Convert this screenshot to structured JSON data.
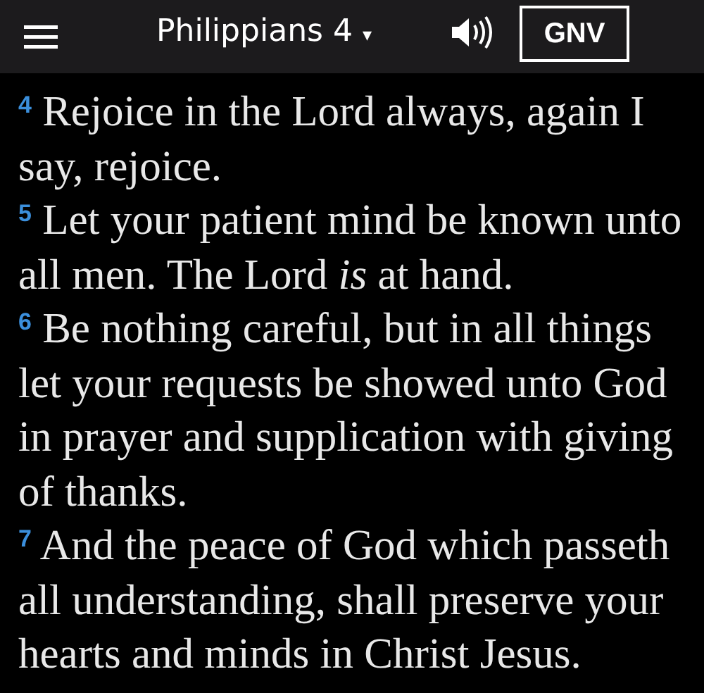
{
  "header": {
    "title": "Philippians 4",
    "dropdown_caret": "▾",
    "version": "GNV"
  },
  "verses": [
    {
      "number": "4",
      "text": "Rejoice in the Lord always, again I say, rejoice."
    },
    {
      "number": "5",
      "text": "Let your patient mind be known unto all men. The Lord *is* at hand."
    },
    {
      "number": "6",
      "text": "Be nothing careful, but in all things let your requests be showed unto God in prayer and supplication with giving of thanks."
    },
    {
      "number": "7",
      "text": "And the peace of God which passeth all understanding, shall preserve your hearts and minds in Christ Jesus."
    }
  ]
}
